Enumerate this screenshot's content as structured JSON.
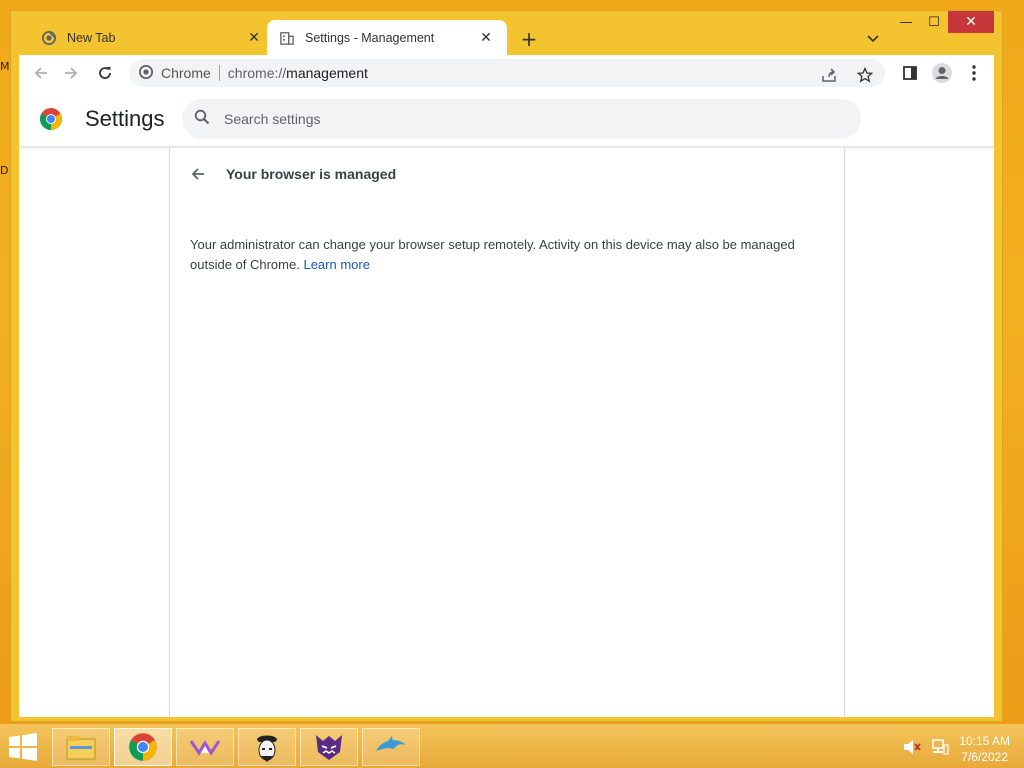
{
  "desktop": {
    "edge_letters": [
      "M",
      "D"
    ]
  },
  "window": {
    "controls": {
      "minimize": "—",
      "maximize": "☐",
      "close": "✕"
    }
  },
  "tabs": [
    {
      "title": "New Tab",
      "icon": "chrome-icon",
      "active": false
    },
    {
      "title": "Settings - Management",
      "icon": "building-icon",
      "active": true
    }
  ],
  "toolbar": {
    "omnibox": {
      "site_label": "Chrome",
      "url_prefix": "chrome://",
      "url_host": "management"
    }
  },
  "settings": {
    "title": "Settings",
    "search_placeholder": "Search settings"
  },
  "management": {
    "heading": "Your browser is managed",
    "description": "Your administrator can change your browser setup remotely. Activity on this device may also be managed outside of Chrome.",
    "learn_more": "Learn more"
  },
  "taskbar": {
    "apps": [
      "file-explorer-icon",
      "chrome-icon",
      "app-purple-icon",
      "anonymous-mask-icon",
      "cat-monster-icon",
      "dolphin-icon"
    ],
    "clock": {
      "time": "10:15 AM",
      "date": "7/6/2022"
    }
  },
  "colors": {
    "accent": "#1a55c6",
    "close_button": "#c7363a",
    "frame": "#f4c430"
  }
}
